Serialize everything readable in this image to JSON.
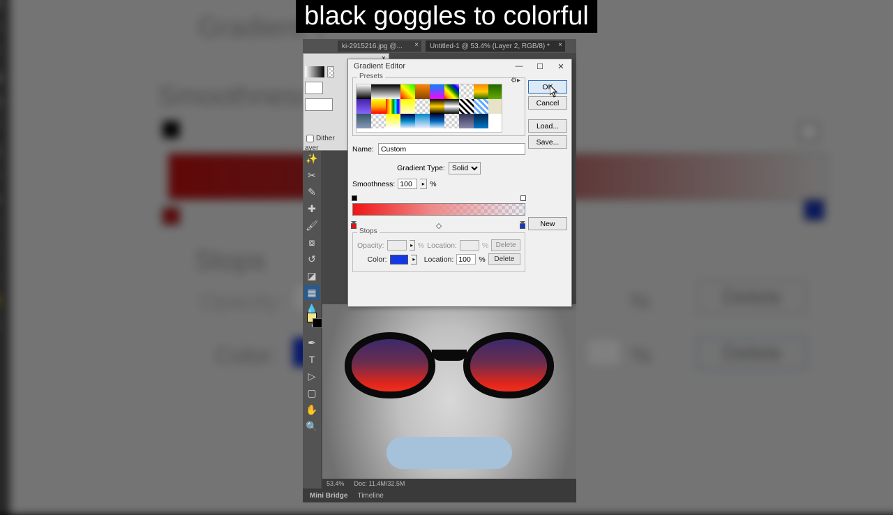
{
  "overlay": {
    "text": "black goggles to colorful"
  },
  "tabs": {
    "tab1": "ki-2915216.jpg @...",
    "tab2": "Untitled-1 @ 53.4% (Layer 2, RGB/8) *"
  },
  "options": {
    "dither": "Dither",
    "layer": "ayer"
  },
  "dialog": {
    "title": "Gradient Editor",
    "presets_label": "Presets",
    "ok": "OK",
    "cancel": "Cancel",
    "load": "Load...",
    "save": "Save...",
    "new": "New",
    "name_label": "Name:",
    "name_value": "Custom",
    "gradient_type_label": "Gradient Type:",
    "gradient_type_value": "Solid",
    "smoothness_label": "Smoothness:",
    "smoothness_value": "100",
    "percent": "%",
    "stops_label": "Stops",
    "opacity_label": "Opacity:",
    "location_label": "Location:",
    "color_label": "Color:",
    "location_value": "100",
    "delete": "Delete",
    "color_value": "#1538e6",
    "stop_left_color": "#e01515",
    "stop_right_color": "#1538c8"
  },
  "status": {
    "zoom": "53.4%",
    "doc": "Doc: 11.4M/32.5M"
  },
  "bottom_tabs": {
    "mini_bridge": "Mini Bridge",
    "timeline": "Timeline"
  },
  "backdrop": {
    "gradient_t": "Gradient T",
    "smoothness": "Smoothness:",
    "stops": "Stops",
    "opacity": "Opacity:",
    "color": "Color:",
    "percent": "%",
    "delete": "Delete"
  }
}
